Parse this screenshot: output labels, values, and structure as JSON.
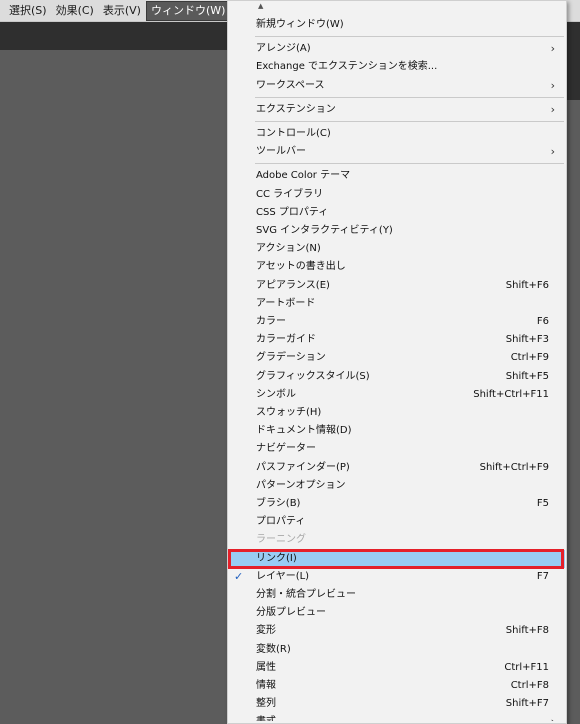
{
  "menubar": {
    "items": [
      {
        "label": "選択(S)",
        "active": false
      },
      {
        "label": "効果(C)",
        "active": false
      },
      {
        "label": "表示(V)",
        "active": false
      },
      {
        "label": "ウィンドウ(W)",
        "active": true
      }
    ]
  },
  "dropdown": {
    "scroll_up_icon": "triangle-up",
    "groups": [
      [
        {
          "label": "新規ウィンドウ(W)"
        }
      ],
      [
        {
          "label": "アレンジ(A)",
          "submenu": true
        },
        {
          "label": "Exchange でエクステンションを検索..."
        },
        {
          "label": "ワークスペース",
          "submenu": true
        }
      ],
      [
        {
          "label": "エクステンション",
          "submenu": true
        }
      ],
      [
        {
          "label": "コントロール(C)"
        },
        {
          "label": "ツールバー",
          "submenu": true
        }
      ],
      [
        {
          "label": "Adobe Color テーマ"
        },
        {
          "label": "CC ライブラリ"
        },
        {
          "label": "CSS プロパティ"
        },
        {
          "label": "SVG インタラクティビティ(Y)"
        },
        {
          "label": "アクション(N)"
        },
        {
          "label": "アセットの書き出し"
        },
        {
          "label": "アピアランス(E)",
          "shortcut": "Shift+F6"
        },
        {
          "label": "アートボード"
        },
        {
          "label": "カラー",
          "shortcut": "F6"
        },
        {
          "label": "カラーガイド",
          "shortcut": "Shift+F3"
        },
        {
          "label": "グラデーション",
          "shortcut": "Ctrl+F9"
        },
        {
          "label": "グラフィックスタイル(S)",
          "shortcut": "Shift+F5"
        },
        {
          "label": "シンボル",
          "shortcut": "Shift+Ctrl+F11"
        },
        {
          "label": "スウォッチ(H)"
        },
        {
          "label": "ドキュメント情報(D)"
        },
        {
          "label": "ナビゲーター"
        },
        {
          "label": "パスファインダー(P)",
          "shortcut": "Shift+Ctrl+F9"
        },
        {
          "label": "パターンオプション"
        },
        {
          "label": "ブラシ(B)",
          "shortcut": "F5"
        },
        {
          "label": "プロパティ"
        },
        {
          "label": "ラーニング",
          "disabled": true
        },
        {
          "label": "リンク(I)",
          "highlighted": true
        },
        {
          "label": "レイヤー(L)",
          "shortcut": "F7",
          "checked": true
        },
        {
          "label": "分割・統合プレビュー"
        },
        {
          "label": "分版プレビュー"
        },
        {
          "label": "変形",
          "shortcut": "Shift+F8"
        },
        {
          "label": "変数(R)"
        },
        {
          "label": "属性",
          "shortcut": "Ctrl+F11"
        },
        {
          "label": "情報",
          "shortcut": "Ctrl+F8"
        },
        {
          "label": "整列",
          "shortcut": "Shift+F7"
        },
        {
          "label": "書式",
          "submenu": true,
          "partial": true
        }
      ]
    ]
  },
  "colors": {
    "highlight_fill": "#99ccf3",
    "highlight_border": "#e4202a",
    "check_color": "#1f5fbf"
  }
}
